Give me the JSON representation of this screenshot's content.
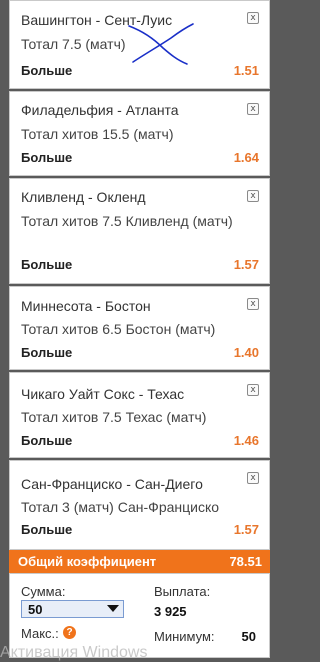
{
  "bets": [
    {
      "teams": "Вашингтон - Сент-Луис",
      "market": "Тотал 7.5 (матч)",
      "pick": "Больше",
      "odds": "1.51"
    },
    {
      "teams": "Филадельфия - Атланта",
      "market": "Тотал хитов 15.5 (матч)",
      "pick": "Больше",
      "odds": "1.64"
    },
    {
      "teams": "Кливленд - Окленд",
      "market": "Тотал хитов 7.5 Кливленд (матч)",
      "pick": "Больше",
      "odds": "1.57"
    },
    {
      "teams": "Миннесота - Бостон",
      "market": "Тотал хитов 6.5 Бостон (матч)",
      "pick": "Больше",
      "odds": "1.40"
    },
    {
      "teams": "Чикаго Уайт Сокс - Техас",
      "market": "Тотал хитов 7.5 Техас (матч)",
      "pick": "Больше",
      "odds": "1.46"
    },
    {
      "teams": "Сан-Франциско - Сан-Диего",
      "market": "Тотал 3 (матч) Сан-Франциско",
      "pick": "Больше",
      "odds": "1.57"
    }
  ],
  "close_glyph": "x",
  "total": {
    "label": "Общий коэффициент",
    "value": "78.51"
  },
  "stake": {
    "label": "Сумма:",
    "value": "50",
    "max_label": "Макс.:",
    "help_glyph": "?"
  },
  "payout": {
    "label": "Выплата:",
    "value": "3 925",
    "min_label": "Минимум:",
    "min_value": "50"
  },
  "watermark": "Активация Windows",
  "colors": {
    "accent": "#f0731b",
    "odds": "#e8762c",
    "scribble": "#1a2fc8"
  }
}
